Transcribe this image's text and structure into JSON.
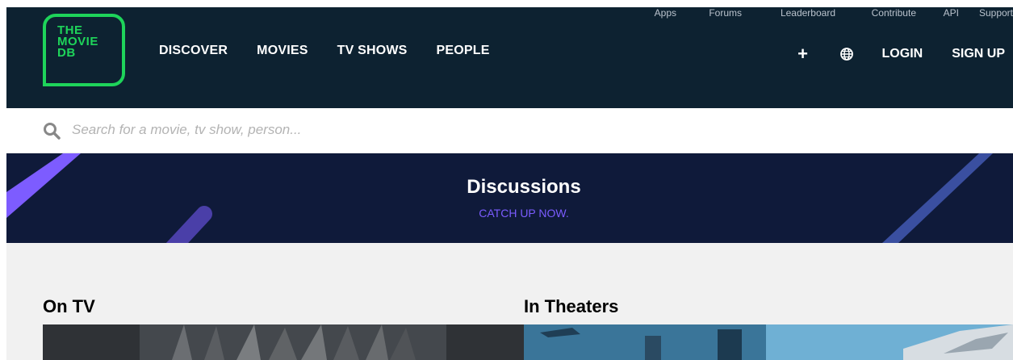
{
  "header": {
    "logo_lines": [
      "THE",
      "MOVIE",
      "DB"
    ],
    "nav_items": [
      "DISCOVER",
      "MOVIES",
      "TV SHOWS",
      "PEOPLE"
    ],
    "sub_nav_items": [
      "Apps",
      "Forums",
      "Leaderboard",
      "Contribute",
      "API",
      "Support"
    ],
    "login_label": "LOGIN",
    "signup_label": "SIGN UP",
    "add_icon": "plus-icon",
    "language_icon": "globe-icon"
  },
  "search": {
    "placeholder": "Search for a movie, tv show, person..."
  },
  "banner": {
    "title": "Discussions",
    "subtitle": "CATCH UP NOW."
  },
  "sections": {
    "on_tv": "On TV",
    "in_theaters": "In Theaters"
  },
  "colors": {
    "header_bg": "#0d2231",
    "logo_green": "#1ed45a",
    "banner_bg": "#0f1a3a",
    "accent_purple": "#7b5cff",
    "content_bg": "#f1f1f1"
  }
}
